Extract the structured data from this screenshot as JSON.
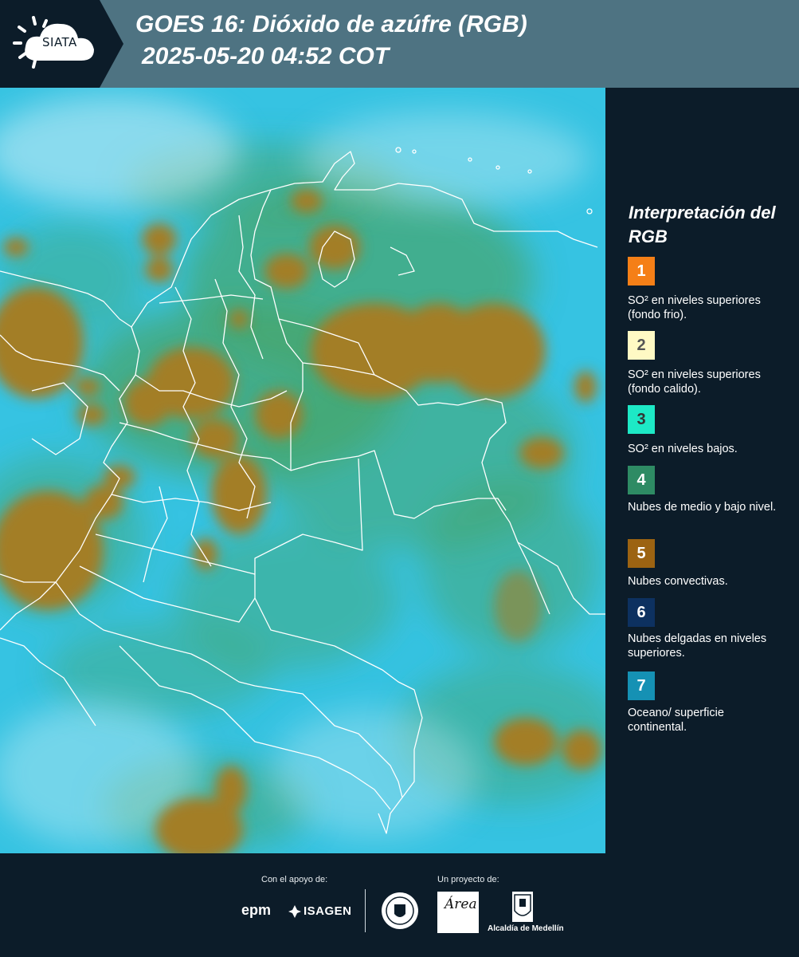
{
  "header": {
    "logo_text": "SIATA",
    "title_line1": "GOES 16: Dióxido de azúfre (RGB)",
    "title_line2": "2025-05-20 04:52 COT"
  },
  "legend": {
    "title": "Interpretación del RGB",
    "items": [
      {
        "number": "1",
        "color": "#f57f17",
        "text_color": "#ffffff",
        "label": "SO² en niveles superiores (fondo frio)."
      },
      {
        "number": "2",
        "color": "#fff9c4",
        "text_color": "#555555",
        "label": "SO² en niveles superiores (fondo calido)."
      },
      {
        "number": "3",
        "color": "#1de9c6",
        "text_color": "#333333",
        "label": "SO² en niveles bajos."
      },
      {
        "number": "4",
        "color": "#2e8b64",
        "text_color": "#ffffff",
        "label": "Nubes de medio y bajo nivel."
      },
      {
        "number": "5",
        "color": "#9c6312",
        "text_color": "#ffffff",
        "label": "Nubes convectivas."
      },
      {
        "number": "6",
        "color": "#0d3160",
        "text_color": "#ffffff",
        "label": "Nubes delgadas en niveles superiores."
      },
      {
        "number": "7",
        "color": "#1591b4",
        "text_color": "#ffffff",
        "label": "Oceano/ superficie continental."
      }
    ]
  },
  "map": {
    "background_color": "#36c3e2",
    "cloud_green": "#47a56c",
    "convective_color": "#a37e28",
    "boundary_color": "#ffffff"
  },
  "footer": {
    "support_label": "Con el apoyo de:",
    "project_label": "Un proyecto de:",
    "sponsor_1": "epm",
    "sponsor_2": "ISAGEN",
    "area_script": "Área",
    "alcaldia": "Alcaldía de Medellín"
  }
}
